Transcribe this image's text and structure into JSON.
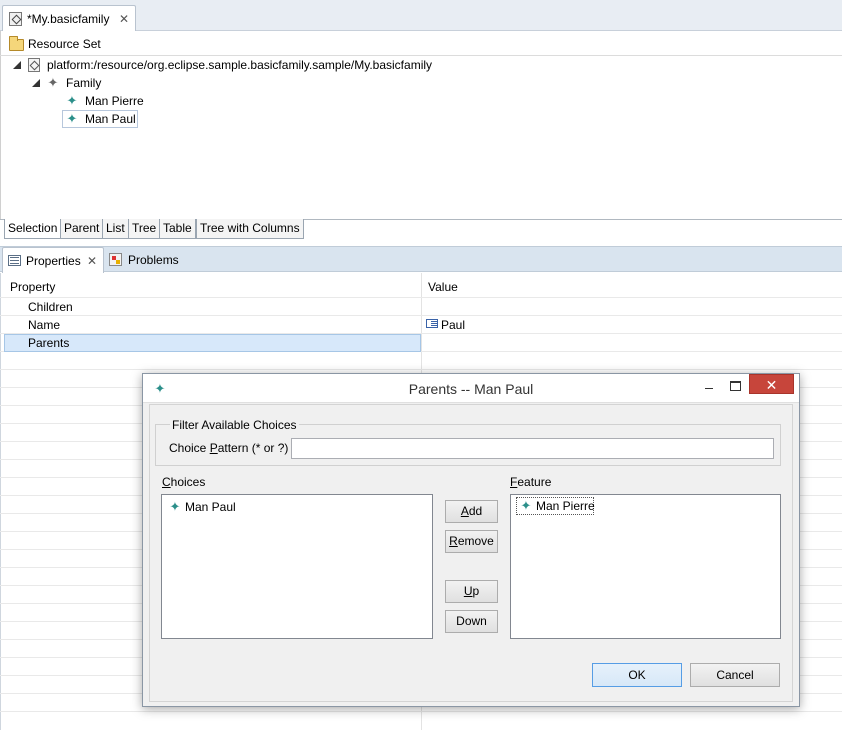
{
  "editor": {
    "tab_title": "*My.basicfamily",
    "resource_set_label": "Resource Set",
    "tree": {
      "resource_uri": "platform:/resource/org.eclipse.sample.basicfamily.sample/My.basicfamily",
      "family": "Family",
      "members": [
        "Man Pierre",
        "Man Paul"
      ]
    },
    "pages": [
      "Selection",
      "Parent",
      "List",
      "Tree",
      "Table",
      "Tree with Columns"
    ]
  },
  "views": {
    "properties_tab": "Properties",
    "problems_tab": "Problems"
  },
  "properties": {
    "header_property": "Property",
    "header_value": "Value",
    "rows": [
      {
        "name": "Children",
        "value": ""
      },
      {
        "name": "Name",
        "value": "Paul"
      },
      {
        "name": "Parents",
        "value": ""
      }
    ]
  },
  "dialog": {
    "title": "Parents -- Man Paul",
    "close_glyph": "✕",
    "filter_group_label": "Filter Available Choices",
    "choice_pattern_label_pre": "Choice ",
    "choice_pattern_label_u": "P",
    "choice_pattern_label_post": "attern (* or ?)",
    "pattern_value": "",
    "choices_label_u": "C",
    "choices_label_rest": "hoices",
    "feature_label_u": "F",
    "feature_label_rest": "eature",
    "choices": [
      "Man Paul"
    ],
    "feature": [
      "Man Pierre"
    ],
    "add_u": "A",
    "add_rest": "dd",
    "remove_u": "R",
    "remove_rest": "emove",
    "up_u": "U",
    "up_rest": "p",
    "down_label": "Down",
    "ok_label": "OK",
    "cancel_label": "Cancel"
  },
  "icons": {
    "eobject": "star-icon",
    "accent": "#2b8f8a"
  }
}
